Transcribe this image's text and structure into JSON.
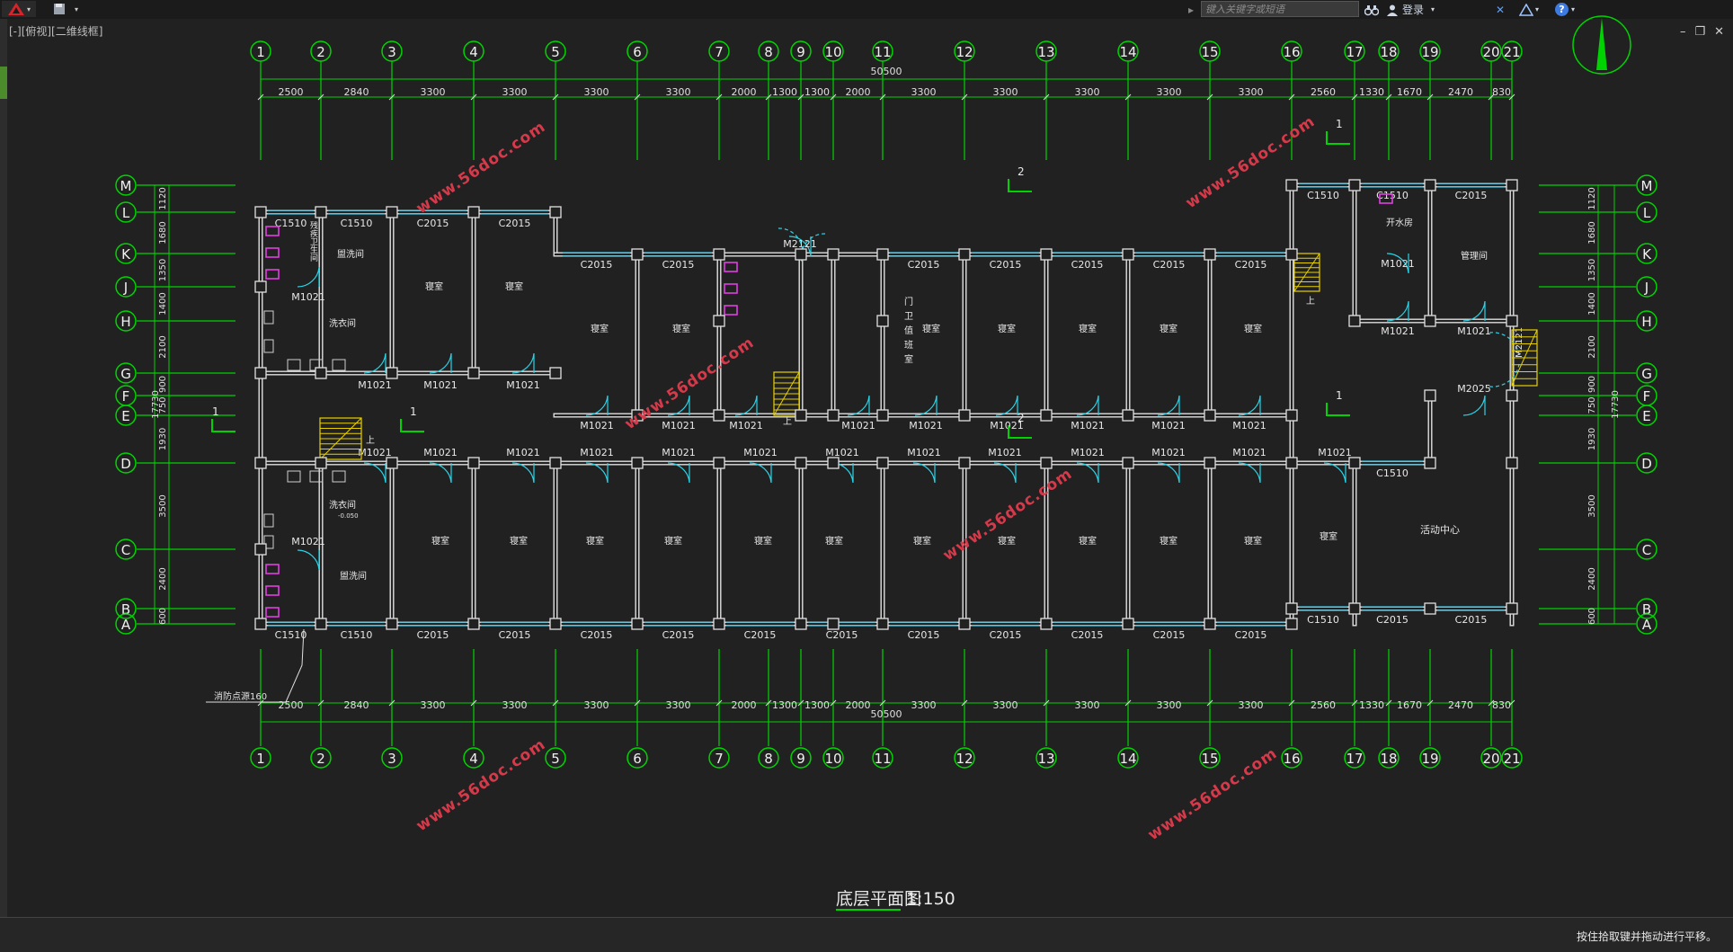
{
  "app": {
    "search_placeholder": "键入关键字或短语",
    "login_label": "登录",
    "help_label": "?",
    "document_tab": "[-][俯视][二维线框]",
    "status_message": "按住拾取键并拖动进行平移。"
  },
  "drawing": {
    "title": "底层平面图",
    "scale": "1:150",
    "total_width": "50500",
    "total_depth": "17730",
    "column_axes": [
      "1",
      "2",
      "3",
      "4",
      "5",
      "6",
      "7",
      "8",
      "9",
      "10",
      "11",
      "12",
      "13",
      "14",
      "15",
      "16",
      "17",
      "18",
      "19",
      "20",
      "21"
    ],
    "column_spacings": [
      "2500",
      "2840",
      "3300",
      "3300",
      "3300",
      "3300",
      "2000",
      "1300",
      "1300",
      "2000",
      "3300",
      "3300",
      "3300",
      "3300",
      "3300",
      "2560",
      "1330",
      "1670",
      "2470",
      "830"
    ],
    "row_axes": [
      "M",
      "L",
      "K",
      "J",
      "H",
      "G",
      "F",
      "E",
      "D",
      "C",
      "B",
      "A"
    ],
    "row_spacings": [
      "1120",
      "1680",
      "1350",
      "1400",
      "2100",
      "900",
      "750",
      "1930",
      "3500",
      "2400",
      "600"
    ],
    "room_labels": {
      "dorm": "寝室",
      "laundry": "洗衣间",
      "washroom": "盥洗间",
      "boiling_water": "开水房",
      "management": "管理间",
      "activity": "活动中心",
      "duty_room": "门卫值班室",
      "accessible_wc": "残疾卫生间"
    },
    "window_labels": [
      "C1510",
      "C2015"
    ],
    "door_labels": [
      "M1021",
      "M2121",
      "M2025",
      "M2121"
    ],
    "section_labels": [
      "1",
      "2"
    ],
    "elevation_note": "-0.050",
    "stair_note": "上",
    "callout": "消防点源160",
    "watermark": "www.56doc.com"
  },
  "colors": {
    "background": "#212121",
    "axis_green": "#00d400",
    "wall": "#e0e0e0",
    "window_cyan": "#49c7e6",
    "door_cyan": "#2bd3e6",
    "stair_yellow": "#e8d000",
    "fixture_magenta": "#e03fe0",
    "watermark_red": "#d63a4a"
  }
}
